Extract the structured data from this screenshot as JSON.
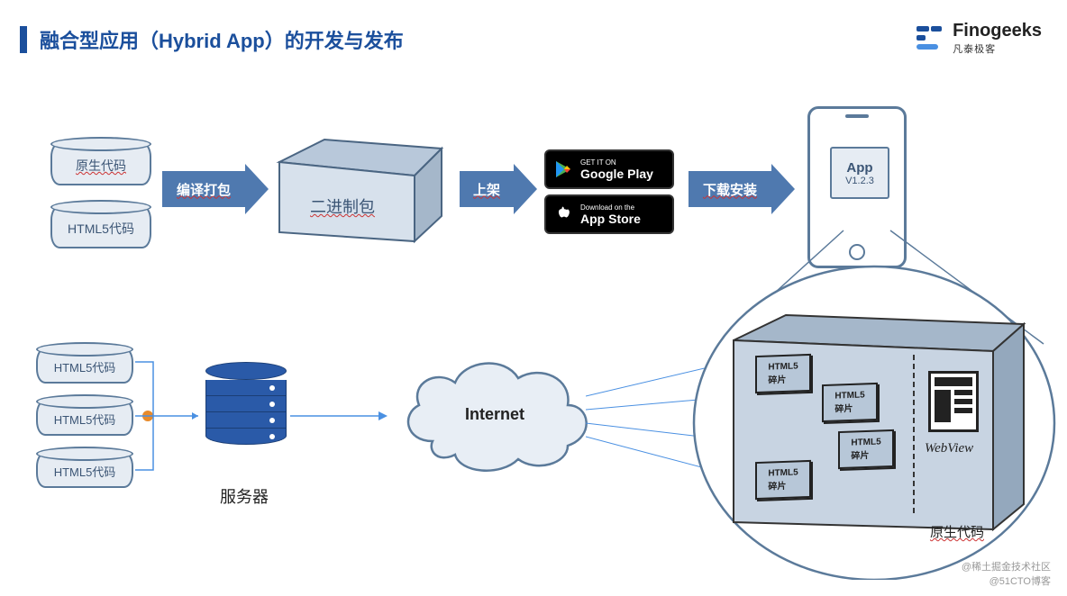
{
  "title": "融合型应用（Hybrid App）的开发与发布",
  "brand": {
    "name": "Finogeeks",
    "sub": "凡泰极客"
  },
  "topFlow": {
    "cyl1": "原生代码",
    "cyl2": "HTML5代码",
    "arrow1": "编译打包",
    "box": "二进制包",
    "arrow2": "上架",
    "store1": {
      "line1": "GET IT ON",
      "line2": "Google Play"
    },
    "store2": {
      "line1": "Download on the",
      "line2": "App Store"
    },
    "arrow3": "下载安装",
    "app": {
      "title": "App",
      "ver": "V1.2.3"
    }
  },
  "bottomFlow": {
    "cyls": [
      "HTML5代码",
      "HTML5代码",
      "HTML5代码"
    ],
    "server": "服务器",
    "cloud": "Internet",
    "detail": {
      "frags": [
        "HTML5碎片",
        "HTML5碎片",
        "HTML5碎片",
        "HTML5碎片"
      ],
      "webview": "WebView",
      "native": "原生代码"
    }
  },
  "watermark": {
    "l1": "@稀土掘金技术社区",
    "l2": "@51CTO博客"
  }
}
